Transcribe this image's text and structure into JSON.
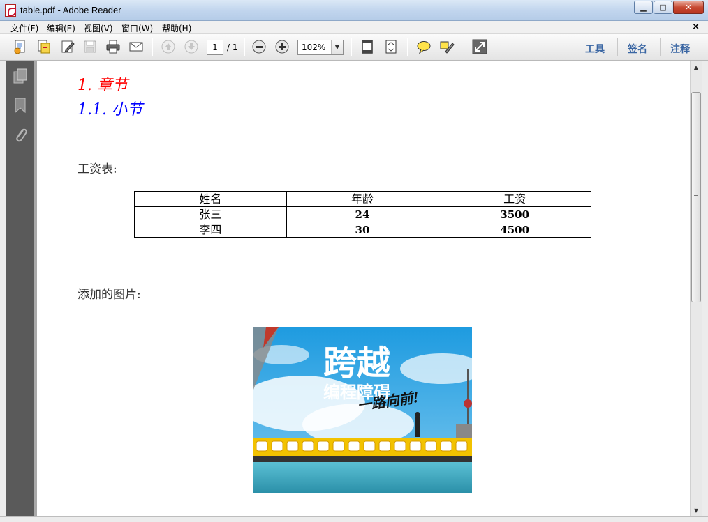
{
  "window": {
    "title": "table.pdf - Adobe Reader",
    "minimize": "▁",
    "maximize": "□",
    "close": "✕"
  },
  "menubar": {
    "items": [
      "文件(F)",
      "编辑(E)",
      "视图(V)",
      "窗口(W)",
      "帮助(H)"
    ],
    "close_doc": "×"
  },
  "toolbar": {
    "page_current": "1",
    "page_total": "/ 1",
    "zoom": "102%",
    "zoom_dropdown": "▼",
    "icons": [
      "create-pdf-icon",
      "combine-files-icon",
      "edit-icon",
      "save-icon",
      "print-icon",
      "email-icon",
      "prev-page-icon",
      "next-page-icon",
      "zoom-out-icon",
      "zoom-in-icon",
      "fit-page-icon",
      "fit-width-icon",
      "comment-icon",
      "highlight-icon",
      "fullscreen-icon"
    ],
    "right_links": [
      "工具",
      "签名",
      "注释"
    ]
  },
  "left_panel": {
    "icons": [
      "pages-icon",
      "bookmarks-icon",
      "attachments-icon"
    ]
  },
  "document": {
    "heading1": "1. 章节",
    "heading2": "1.1. 小节",
    "salary_label": "工资表:",
    "table": {
      "headers": [
        "姓名",
        "年龄",
        "工资"
      ],
      "rows": [
        [
          "张三",
          "24",
          "3500"
        ],
        [
          "李四",
          "30",
          "4500"
        ]
      ]
    },
    "image_label": "添加的图片:",
    "image": {
      "title": "跨越",
      "subtitle": "编程障碍",
      "slogan": "一路向前!"
    }
  },
  "scrollbar": {
    "up": "▲",
    "down": "▼"
  },
  "colors": {
    "heading1": "#ff0000",
    "heading2": "#0000ff",
    "toolbar_link": "#3a66a3",
    "sky": "#3ea7e0"
  }
}
